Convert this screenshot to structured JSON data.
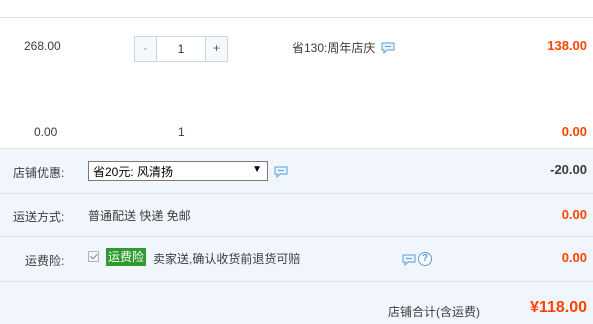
{
  "item1": {
    "unit_price": "268.00",
    "quantity": "1",
    "minus_label": "-",
    "plus_label": "+",
    "promotion": "省130:周年店庆",
    "subtotal": "138.00"
  },
  "item2": {
    "unit_price": "0.00",
    "quantity": "1",
    "subtotal": "0.00"
  },
  "shop": {
    "discount_label": "店铺优惠:",
    "discount_selected": "省20元: 风清扬",
    "discount_arrow": "▼",
    "discount_amount": "-20.00",
    "shipping_label": "运送方式:",
    "shipping_method": "普通配送 快递 免邮",
    "shipping_amount": "0.00",
    "insurance_label": "运费险:",
    "insurance_badge": "运费险",
    "insurance_desc": "卖家送,确认收货前退货可赔",
    "insurance_help": "?",
    "insurance_amount": "0.00",
    "total_label": "店铺合计(含运费)",
    "total_amount": "¥118.00"
  },
  "colors": {
    "price_red": "#ff4400",
    "section_bg": "#f1f6fd",
    "badge_green": "#2f9a2f",
    "icon_blue": "#5aa0d6"
  },
  "icons": {
    "chat": "speech-bubble-icon",
    "help": "question-circle-icon",
    "check": "checkbox-checked-icon"
  }
}
